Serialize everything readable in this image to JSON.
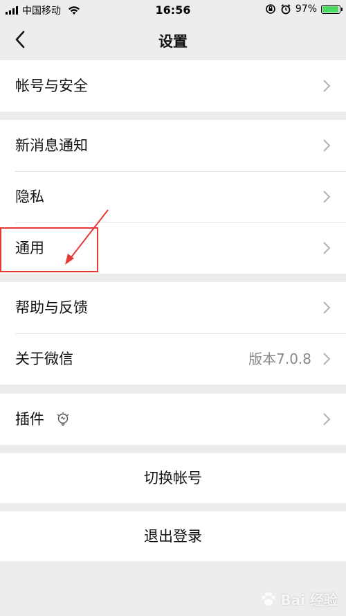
{
  "status_bar": {
    "carrier": "中国移动",
    "time": "16:56",
    "battery_percent_label": "97%",
    "battery_level": 0.97
  },
  "nav": {
    "title": "设置"
  },
  "groups": [
    {
      "items": [
        {
          "label": "帐号与安全"
        }
      ]
    },
    {
      "items": [
        {
          "label": "新消息通知"
        },
        {
          "label": "隐私"
        },
        {
          "label": "通用"
        }
      ]
    },
    {
      "items": [
        {
          "label": "帮助与反馈"
        },
        {
          "label": "关于微信",
          "value": "版本7.0.8"
        }
      ]
    },
    {
      "items": [
        {
          "label": "插件"
        }
      ]
    }
  ],
  "actions": {
    "switch_account": "切换帐号",
    "logout": "退出登录"
  },
  "watermark": {
    "text": "Bai 经验"
  },
  "colors": {
    "background": "#ededed",
    "annotation": "#e53935",
    "battery": "#4cd964"
  }
}
